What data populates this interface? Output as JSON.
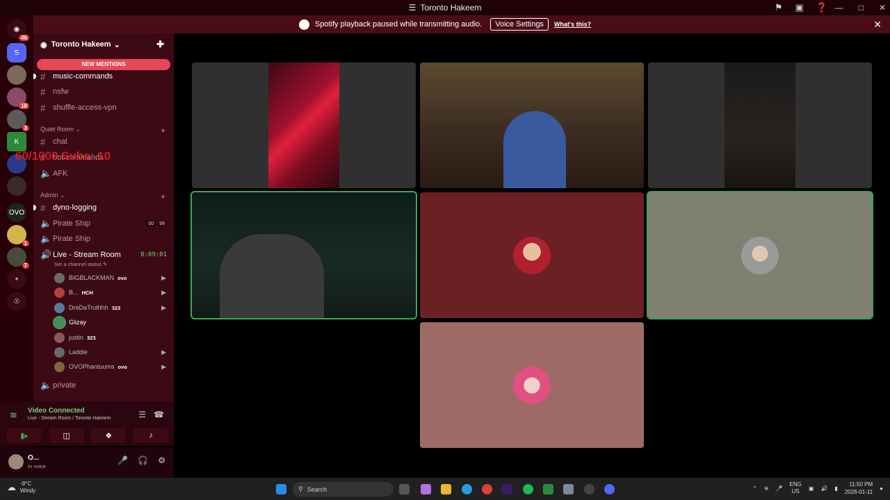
{
  "window": {
    "title": "Toronto Hakeem"
  },
  "banner": {
    "text": "Spotify playback paused while transmitting audio.",
    "button": "Voice Settings",
    "link": "What's this?"
  },
  "guilds": [
    {
      "badge": "46"
    },
    {
      "badge": ""
    },
    {
      "badge": ""
    },
    {
      "badge": "18"
    },
    {
      "badge": "3"
    },
    {
      "badge": ""
    },
    {
      "badge": ""
    },
    {
      "badge": ""
    },
    {
      "badge": ""
    },
    {
      "badge": "1"
    },
    {
      "badge": "7"
    }
  ],
  "server": {
    "name": "Toronto Hakeem",
    "new_mentions": "NEW MENTIONS"
  },
  "channels": {
    "music_commands": "music-commands",
    "nsfw": "nsfw",
    "shuffle": "shuffle-access-vpn",
    "cat_quiet": "Quiet Room",
    "chat": "chat",
    "bot_commands": "bot-commands",
    "afk": "AFK",
    "cat_admin": "Admin",
    "dyno": "dyno-logging",
    "pirate1": "Pirate Ship",
    "pirate1_counts": [
      "00",
      "99"
    ],
    "pirate2": "Pirate Ship",
    "live": "Live - Stream Room",
    "live_timer": "8:09:01",
    "live_status": "Set a channel status",
    "private": "private"
  },
  "members": [
    {
      "name": "BIGBLACKMAN",
      "tag": "ovo",
      "cam": true
    },
    {
      "name": "B...",
      "tag": "HCH",
      "cam": true
    },
    {
      "name": "DreDaTruthhh",
      "tag": "323",
      "cam": true
    },
    {
      "name": "Glizay",
      "tag": "",
      "cam": false
    },
    {
      "name": "justin",
      "tag": "323",
      "cam": false
    },
    {
      "name": "Laddie",
      "tag": "",
      "cam": true
    },
    {
      "name": "OVOPhantuums",
      "tag": "ovo",
      "cam": true
    }
  ],
  "overlay_text": "60/1000 Subs: 10",
  "voice": {
    "status": "Video Connected",
    "location": "Live - Stream Room / Toronto Hakeem"
  },
  "user": {
    "name": "O...",
    "status": "In voice"
  },
  "taskbar": {
    "temp": "-9°C",
    "cond": "Windy",
    "search": "Search",
    "lang1": "ENG",
    "lang2": "US",
    "time": "11:50 PM",
    "date": "2026-01-11"
  },
  "tile_colors": {
    "red_tile": "#6b2024",
    "gray_tile": "#808070",
    "pink_tile": "#9e6a66",
    "accent_green": "#3ba55c"
  }
}
